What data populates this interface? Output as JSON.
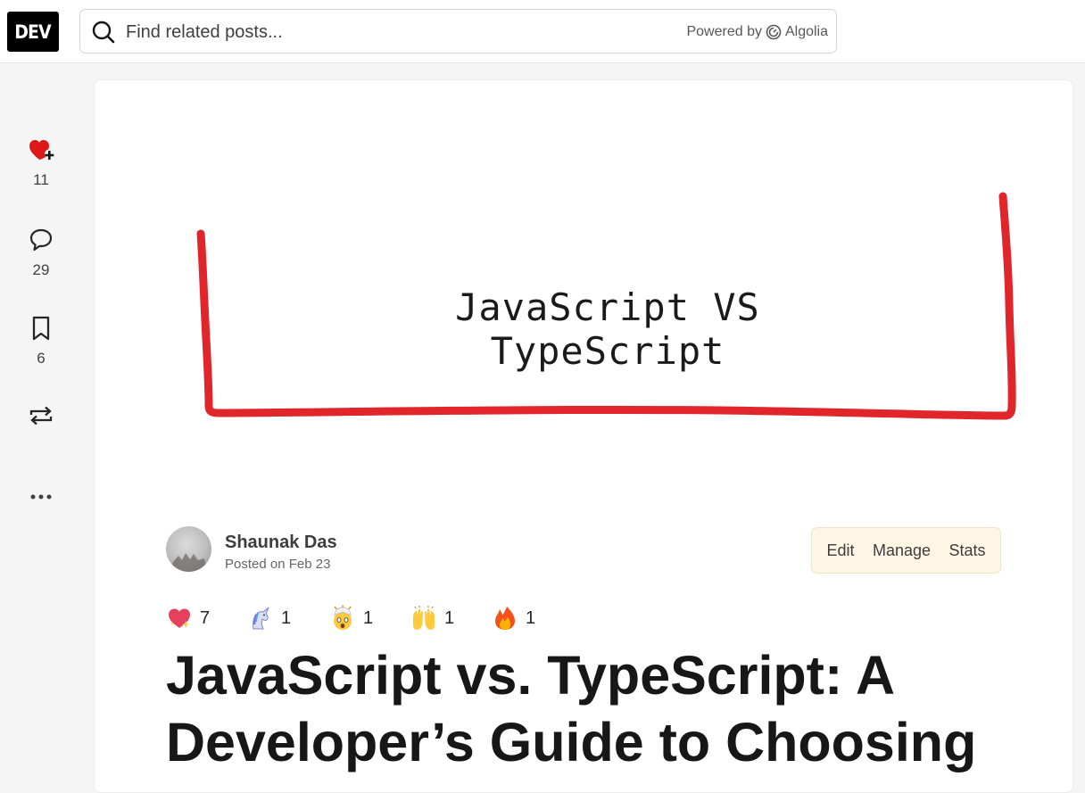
{
  "header": {
    "logo_text": "DEV",
    "search_placeholder": "Find related posts...",
    "powered_by": "Powered by",
    "powered_brand": "Algolia"
  },
  "rail": {
    "reactions_count": "11",
    "comments_count": "29",
    "bookmarks_count": "6"
  },
  "article": {
    "cover_text": "JavaScript VS TypeScript",
    "author_name": "Shaunak Das",
    "posted": "Posted on Feb 23",
    "actions": {
      "edit": "Edit",
      "manage": "Manage",
      "stats": "Stats"
    },
    "reactions": [
      {
        "icon": "sparkle-heart-icon",
        "count": "7"
      },
      {
        "icon": "unicorn-icon",
        "count": "1"
      },
      {
        "icon": "exploding-head-icon",
        "count": "1"
      },
      {
        "icon": "raised-hands-icon",
        "count": "1"
      },
      {
        "icon": "fire-icon",
        "count": "1"
      }
    ],
    "title": "JavaScript vs. TypeScript: A Developer’s Guide to Choosing"
  },
  "colors": {
    "heart": "#dc1818",
    "frame_red": "#e0262a",
    "actions_bg": "#fff6e6"
  }
}
